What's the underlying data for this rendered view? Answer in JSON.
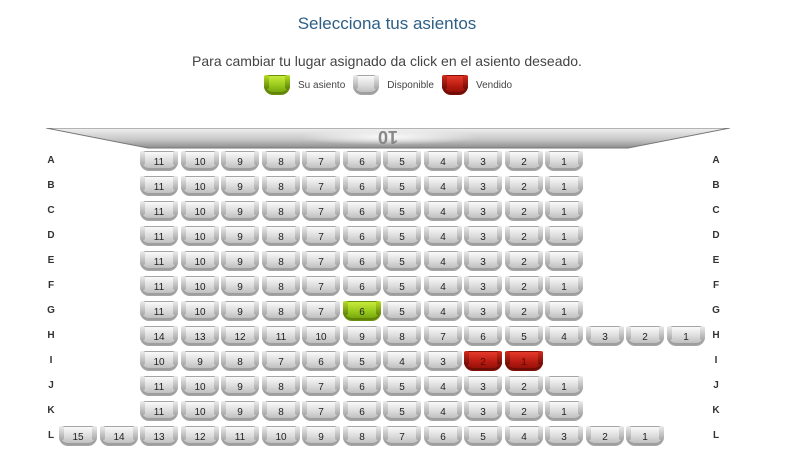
{
  "header": {
    "title": "Selecciona tus asientos",
    "instructions": "Para cambiar tu lugar asignado da click en el asiento deseado."
  },
  "legend": [
    {
      "status": "mine",
      "label": "Su asiento"
    },
    {
      "status": "available",
      "label": "Disponible"
    },
    {
      "status": "sold",
      "label": "Vendido"
    }
  ],
  "screen": {
    "label": "10"
  },
  "colors": {
    "title": "#2d5f86",
    "mine": "#95c71a",
    "available": "#d9d9d9",
    "sold": "#b81b11"
  },
  "rows": [
    {
      "label": "A",
      "seats": [
        {
          "n": "11",
          "s": "available"
        },
        {
          "n": "10",
          "s": "available"
        },
        {
          "n": "9",
          "s": "available"
        },
        {
          "n": "8",
          "s": "available"
        },
        {
          "n": "7",
          "s": "available"
        },
        {
          "n": "6",
          "s": "available"
        },
        {
          "n": "5",
          "s": "available"
        },
        {
          "n": "4",
          "s": "available"
        },
        {
          "n": "3",
          "s": "available"
        },
        {
          "n": "2",
          "s": "available"
        },
        {
          "n": "1",
          "s": "available"
        }
      ]
    },
    {
      "label": "B",
      "seats": [
        {
          "n": "11",
          "s": "available"
        },
        {
          "n": "10",
          "s": "available"
        },
        {
          "n": "9",
          "s": "available"
        },
        {
          "n": "8",
          "s": "available"
        },
        {
          "n": "7",
          "s": "available"
        },
        {
          "n": "6",
          "s": "available"
        },
        {
          "n": "5",
          "s": "available"
        },
        {
          "n": "4",
          "s": "available"
        },
        {
          "n": "3",
          "s": "available"
        },
        {
          "n": "2",
          "s": "available"
        },
        {
          "n": "1",
          "s": "available"
        }
      ]
    },
    {
      "label": "C",
      "seats": [
        {
          "n": "11",
          "s": "available"
        },
        {
          "n": "10",
          "s": "available"
        },
        {
          "n": "9",
          "s": "available"
        },
        {
          "n": "8",
          "s": "available"
        },
        {
          "n": "7",
          "s": "available"
        },
        {
          "n": "6",
          "s": "available"
        },
        {
          "n": "5",
          "s": "available"
        },
        {
          "n": "4",
          "s": "available"
        },
        {
          "n": "3",
          "s": "available"
        },
        {
          "n": "2",
          "s": "available"
        },
        {
          "n": "1",
          "s": "available"
        }
      ]
    },
    {
      "label": "D",
      "seats": [
        {
          "n": "11",
          "s": "available"
        },
        {
          "n": "10",
          "s": "available"
        },
        {
          "n": "9",
          "s": "available"
        },
        {
          "n": "8",
          "s": "available"
        },
        {
          "n": "7",
          "s": "available"
        },
        {
          "n": "6",
          "s": "available"
        },
        {
          "n": "5",
          "s": "available"
        },
        {
          "n": "4",
          "s": "available"
        },
        {
          "n": "3",
          "s": "available"
        },
        {
          "n": "2",
          "s": "available"
        },
        {
          "n": "1",
          "s": "available"
        }
      ]
    },
    {
      "label": "E",
      "seats": [
        {
          "n": "11",
          "s": "available"
        },
        {
          "n": "10",
          "s": "available"
        },
        {
          "n": "9",
          "s": "available"
        },
        {
          "n": "8",
          "s": "available"
        },
        {
          "n": "7",
          "s": "available"
        },
        {
          "n": "6",
          "s": "available"
        },
        {
          "n": "5",
          "s": "available"
        },
        {
          "n": "4",
          "s": "available"
        },
        {
          "n": "3",
          "s": "available"
        },
        {
          "n": "2",
          "s": "available"
        },
        {
          "n": "1",
          "s": "available"
        }
      ]
    },
    {
      "label": "F",
      "seats": [
        {
          "n": "11",
          "s": "available"
        },
        {
          "n": "10",
          "s": "available"
        },
        {
          "n": "9",
          "s": "available"
        },
        {
          "n": "8",
          "s": "available"
        },
        {
          "n": "7",
          "s": "available"
        },
        {
          "n": "6",
          "s": "available"
        },
        {
          "n": "5",
          "s": "available"
        },
        {
          "n": "4",
          "s": "available"
        },
        {
          "n": "3",
          "s": "available"
        },
        {
          "n": "2",
          "s": "available"
        },
        {
          "n": "1",
          "s": "available"
        }
      ]
    },
    {
      "label": "G",
      "seats": [
        {
          "n": "11",
          "s": "available"
        },
        {
          "n": "10",
          "s": "available"
        },
        {
          "n": "9",
          "s": "available"
        },
        {
          "n": "8",
          "s": "available"
        },
        {
          "n": "7",
          "s": "available"
        },
        {
          "n": "6",
          "s": "mine"
        },
        {
          "n": "5",
          "s": "available"
        },
        {
          "n": "4",
          "s": "available"
        },
        {
          "n": "3",
          "s": "available"
        },
        {
          "n": "2",
          "s": "available"
        },
        {
          "n": "1",
          "s": "available"
        }
      ]
    },
    {
      "label": "H",
      "seats": [
        {
          "n": "14",
          "s": "available"
        },
        {
          "n": "13",
          "s": "available"
        },
        {
          "n": "12",
          "s": "available"
        },
        {
          "n": "11",
          "s": "available"
        },
        {
          "n": "10",
          "s": "available"
        },
        {
          "n": "9",
          "s": "available"
        },
        {
          "n": "8",
          "s": "available"
        },
        {
          "n": "7",
          "s": "available"
        },
        {
          "n": "6",
          "s": "available"
        },
        {
          "n": "5",
          "s": "available"
        },
        {
          "n": "4",
          "s": "available"
        },
        {
          "n": "3",
          "s": "available"
        },
        {
          "n": "2",
          "s": "available"
        },
        {
          "n": "1",
          "s": "available"
        }
      ]
    },
    {
      "label": "I",
      "seats": [
        {
          "n": "10",
          "s": "available"
        },
        {
          "n": "9",
          "s": "available"
        },
        {
          "n": "8",
          "s": "available"
        },
        {
          "n": "7",
          "s": "available"
        },
        {
          "n": "6",
          "s": "available"
        },
        {
          "n": "5",
          "s": "available"
        },
        {
          "n": "4",
          "s": "available"
        },
        {
          "n": "3",
          "s": "available"
        },
        {
          "n": "2",
          "s": "sold"
        },
        {
          "n": "1",
          "s": "sold"
        }
      ]
    },
    {
      "label": "J",
      "seats": [
        {
          "n": "11",
          "s": "available"
        },
        {
          "n": "10",
          "s": "available"
        },
        {
          "n": "9",
          "s": "available"
        },
        {
          "n": "8",
          "s": "available"
        },
        {
          "n": "7",
          "s": "available"
        },
        {
          "n": "6",
          "s": "available"
        },
        {
          "n": "5",
          "s": "available"
        },
        {
          "n": "4",
          "s": "available"
        },
        {
          "n": "3",
          "s": "available"
        },
        {
          "n": "2",
          "s": "available"
        },
        {
          "n": "1",
          "s": "available"
        }
      ]
    },
    {
      "label": "K",
      "seats": [
        {
          "n": "11",
          "s": "available"
        },
        {
          "n": "10",
          "s": "available"
        },
        {
          "n": "9",
          "s": "available"
        },
        {
          "n": "8",
          "s": "available"
        },
        {
          "n": "7",
          "s": "available"
        },
        {
          "n": "6",
          "s": "available"
        },
        {
          "n": "5",
          "s": "available"
        },
        {
          "n": "4",
          "s": "available"
        },
        {
          "n": "3",
          "s": "available"
        },
        {
          "n": "2",
          "s": "available"
        },
        {
          "n": "1",
          "s": "available"
        }
      ]
    },
    {
      "label": "L",
      "seats": [
        {
          "n": "15",
          "s": "available"
        },
        {
          "n": "14",
          "s": "available"
        },
        {
          "n": "13",
          "s": "available"
        },
        {
          "n": "12",
          "s": "available"
        },
        {
          "n": "11",
          "s": "available"
        },
        {
          "n": "10",
          "s": "available"
        },
        {
          "n": "9",
          "s": "available"
        },
        {
          "n": "8",
          "s": "available"
        },
        {
          "n": "7",
          "s": "available"
        },
        {
          "n": "6",
          "s": "available"
        },
        {
          "n": "5",
          "s": "available"
        },
        {
          "n": "4",
          "s": "available"
        },
        {
          "n": "3",
          "s": "available"
        },
        {
          "n": "2",
          "s": "available"
        },
        {
          "n": "1",
          "s": "available"
        }
      ]
    }
  ]
}
